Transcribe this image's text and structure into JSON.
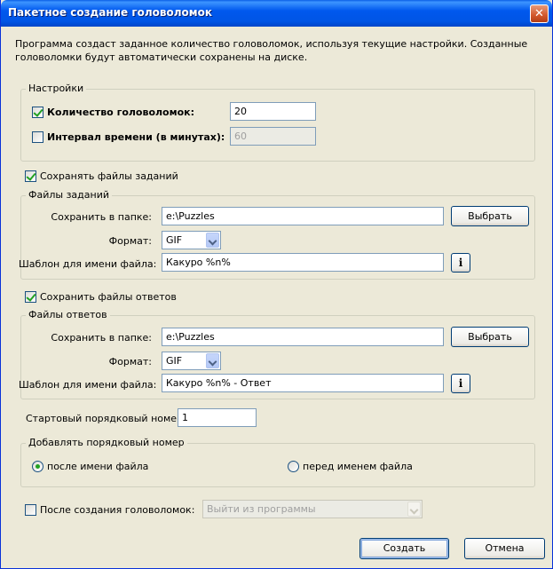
{
  "window": {
    "title": "Пакетное создание головоломок",
    "close_glyph": "✕"
  },
  "description": "Программа создаст заданное количество головоломок, используя текущие настройки. Созданные головоломки будут автоматически сохранены на диске.",
  "settings": {
    "legend": "Настройки",
    "count_label": "Количество головоломок:",
    "count_checked": true,
    "count_value": "20",
    "interval_label": "Интервал времени (в минутах):",
    "interval_checked": false,
    "interval_value": "60"
  },
  "save_tasks": {
    "checkbox_label": "Сохранять файлы заданий",
    "checked": true,
    "legend": "Файлы заданий",
    "folder_label": "Сохранить в папке:",
    "folder_value": "e:\\Puzzles",
    "browse_label": "Выбрать",
    "format_label": "Формат:",
    "format_value": "GIF",
    "template_label": "Шаблон для имени файла:",
    "template_value": "Какуро %n%",
    "info_glyph": "i"
  },
  "save_answers": {
    "checkbox_label": "Сохранить файлы ответов",
    "checked": true,
    "legend": "Файлы ответов",
    "folder_label": "Сохранить в папке:",
    "folder_value": "e:\\Puzzles",
    "browse_label": "Выбрать",
    "format_label": "Формат:",
    "format_value": "GIF",
    "template_label": "Шаблон для имени файла:",
    "template_value": "Какуро %n% - Ответ",
    "info_glyph": "i"
  },
  "start_number": {
    "label": "Стартовый порядковый номер:",
    "value": "1"
  },
  "numbering": {
    "legend": "Добавлять порядковый номер",
    "option_after": "после имени файла",
    "option_before": "перед именем файла",
    "selected": "after"
  },
  "after_creation": {
    "label": "После создания головоломок:",
    "checked": false,
    "action_value": "Выйти из программы"
  },
  "buttons": {
    "create": "Создать",
    "cancel": "Отмена"
  }
}
